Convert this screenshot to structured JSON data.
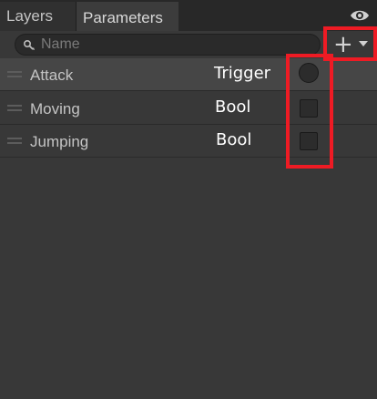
{
  "tabs": [
    {
      "label": "Layers"
    },
    {
      "label": "Parameters"
    }
  ],
  "search": {
    "placeholder": "Name",
    "value": ""
  },
  "icons": {
    "visibility": "eye-icon",
    "search": "search-icon",
    "add": "plus-icon",
    "add_menu": "chevron-down-icon"
  },
  "colors": {
    "highlight": "#ee1b24",
    "background": "#383838",
    "selected_row": "#464646"
  },
  "parameters": [
    {
      "name": "Attack",
      "type": "Trigger",
      "value": false
    },
    {
      "name": "Moving",
      "type": "Bool",
      "value": false
    },
    {
      "name": "Jumping",
      "type": "Bool",
      "value": false
    }
  ]
}
